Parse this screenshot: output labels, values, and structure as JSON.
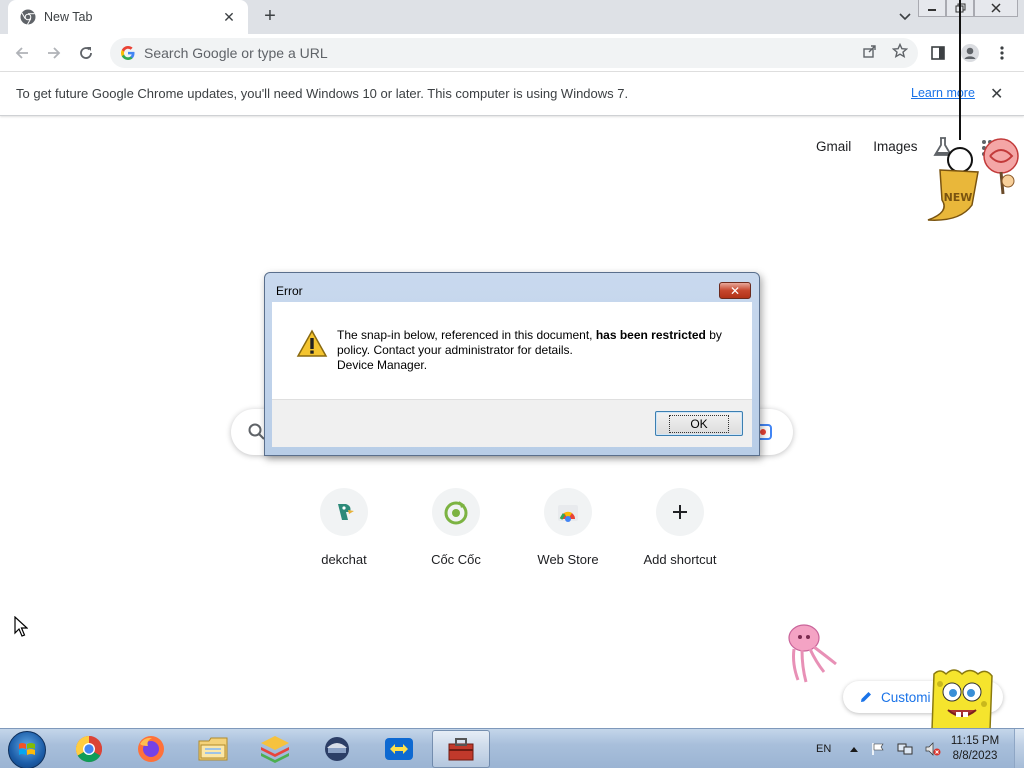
{
  "browser": {
    "tab": {
      "title": "New Tab",
      "favicon": "chrome-icon",
      "close_glyph": "✕"
    },
    "new_tab_glyph": "+",
    "omnibox": {
      "placeholder": "Search Google or type a URL"
    },
    "infobar": {
      "message": "To get future Google Chrome updates, you'll need Windows 10 or later. This computer is using Windows 7.",
      "link": "Learn more",
      "close_glyph": "✕"
    }
  },
  "ntp": {
    "links": [
      "Gmail",
      "Images"
    ],
    "shortcuts": [
      {
        "label": "dekchat",
        "icon": "dekchat-icon"
      },
      {
        "label": "Cốc Cốc",
        "icon": "coccoc-icon"
      },
      {
        "label": "Web Store",
        "icon": "webstore-icon"
      },
      {
        "label": "Add shortcut",
        "icon": "plus-icon"
      }
    ],
    "customize_label": "Customi",
    "sticker_text": "NEW"
  },
  "dialog": {
    "title": "Error",
    "close_glyph": "✕",
    "message_part1": "The snap-in below, referenced in this document, ",
    "message_bold": "has been restricted",
    "message_part2": " by policy. Contact your administrator for details.",
    "message_line3": "Device Manager.",
    "ok_label": "OK"
  },
  "taskbar": {
    "items": [
      "chrome-icon",
      "firefox-icon",
      "file-explorer-icon",
      "bluestacks-icon",
      "vpn-icon",
      "teamviewer-icon",
      "toolbox-icon"
    ],
    "active_index": 6,
    "language": "EN",
    "time": "11:15 PM",
    "date": "8/8/2023"
  },
  "colors": {
    "accent": "#1a73e8",
    "tab_strip": "#dee1e6",
    "dialog_frame": "#b8cde7",
    "taskbar": "#a8bfdb"
  }
}
